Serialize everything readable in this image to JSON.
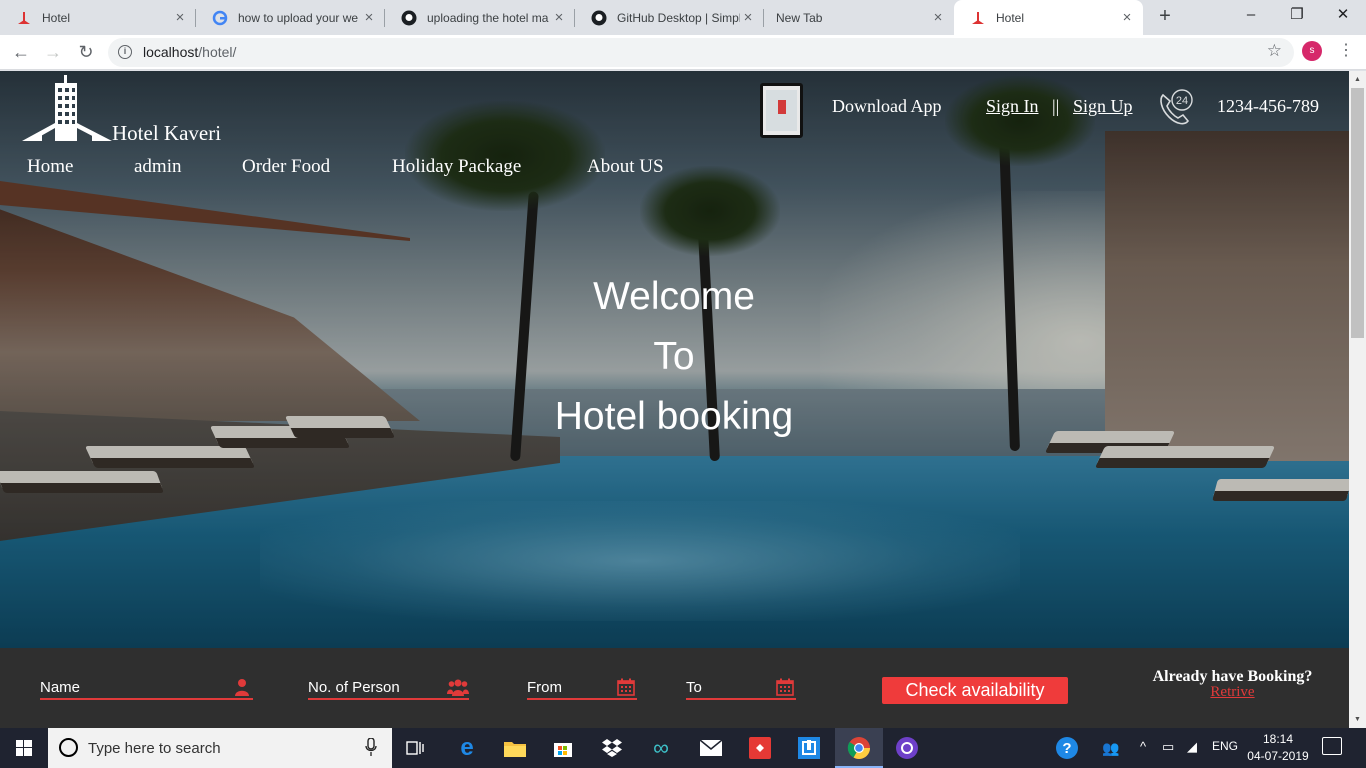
{
  "browser": {
    "tabs": [
      {
        "title": "Hotel",
        "active": false
      },
      {
        "title": "how to upload your we",
        "active": false
      },
      {
        "title": "uploading the hotel ma",
        "active": false
      },
      {
        "title": "GitHub Desktop | Simpl",
        "active": false
      },
      {
        "title": "New Tab",
        "active": false
      },
      {
        "title": "Hotel",
        "active": true
      }
    ],
    "url_host": "localhost",
    "url_path": "/hotel/",
    "profile_initial": "s"
  },
  "site": {
    "brand": "Hotel Kaveri",
    "nav": [
      "Home",
      "admin",
      "Order Food",
      "Holiday Package",
      "About US"
    ],
    "download_app": "Download App",
    "sign_in": "Sign In",
    "separator": "||",
    "sign_up": "Sign Up",
    "phone": "1234-456-789",
    "call_badge": "24",
    "welcome_lines": [
      "Welcome",
      "To",
      "Hotel booking"
    ],
    "booking": {
      "name_label": "Name",
      "persons_label": "No. of Person",
      "from_label": "From",
      "to_label": "To",
      "check_button": "Check availability",
      "already_text": "Already have Booking?",
      "retrive_link": "Retrive"
    },
    "colors": {
      "accent": "#ef3b3b",
      "booking_bg": "#2f2f2f"
    }
  },
  "taskbar": {
    "search_placeholder": "Type here to search",
    "language": "ENG",
    "time": "18:14",
    "date": "04-07-2019"
  }
}
